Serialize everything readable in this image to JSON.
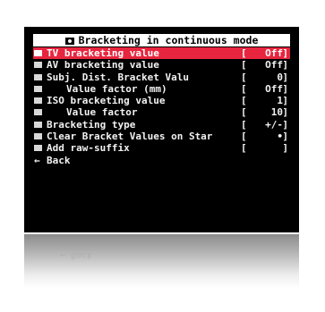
{
  "title": "Bracketing in continuous mode",
  "menu": [
    {
      "label": "TV bracketing value",
      "open": "[",
      "value": "Off",
      "close": "]",
      "selected": true,
      "indent": false
    },
    {
      "label": "AV bracketing value",
      "open": "[",
      "value": "Off",
      "close": "]",
      "selected": false,
      "indent": false
    },
    {
      "label": "Subj. Dist. Bracket Valu",
      "open": "[",
      "value": "0",
      "close": "]",
      "selected": false,
      "indent": false
    },
    {
      "label": "Value factor (mm)",
      "open": "[",
      "value": "Off",
      "close": "]",
      "selected": false,
      "indent": true
    },
    {
      "label": "ISO bracketing value",
      "open": "[",
      "value": "1",
      "close": "]",
      "selected": false,
      "indent": false
    },
    {
      "label": "Value factor",
      "open": "[",
      "value": "10",
      "close": "]",
      "selected": false,
      "indent": true
    },
    {
      "label": "Bracketing type",
      "open": "[",
      "value": "+/-",
      "close": "]",
      "selected": false,
      "indent": false
    },
    {
      "label": "Clear Bracket Values on Star",
      "open": "[",
      "value": "•",
      "close": "]",
      "selected": false,
      "indent": false
    },
    {
      "label": "Add raw-suffix",
      "open": "[",
      "value": " ",
      "close": "]",
      "selected": false,
      "indent": false
    }
  ],
  "back": {
    "label": "Back",
    "icon": "back-arrow-icon"
  },
  "colors": {
    "highlight": "#e8253e",
    "background": "#000000",
    "text": "#f2f2f2"
  }
}
